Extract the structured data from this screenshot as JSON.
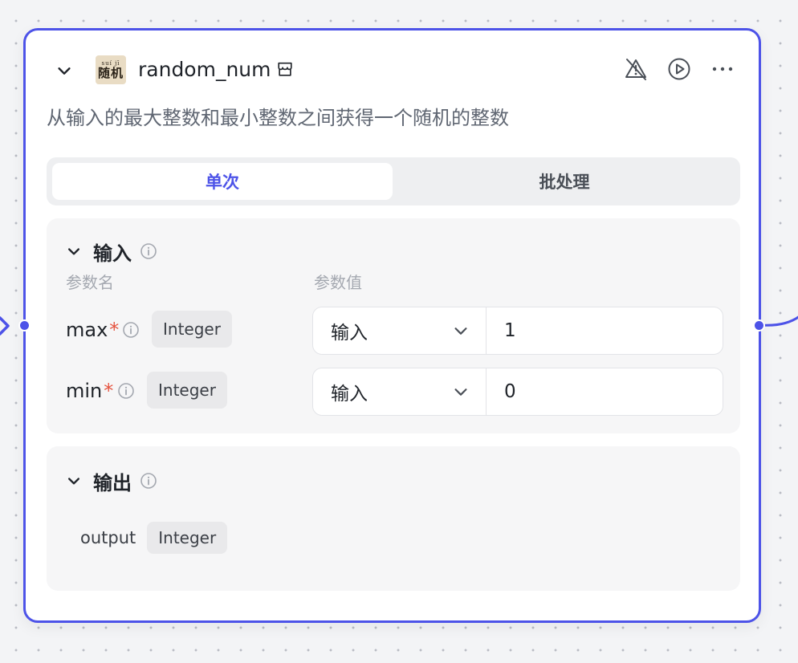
{
  "node": {
    "title": "random_num",
    "description": "从输入的最大整数和最小整数之间获得一个随机的整数",
    "logo": {
      "pinyin": "suí jī",
      "hanzi": "随机"
    },
    "accent_color": "#4d53e8"
  },
  "mode_tabs": [
    {
      "label": "单次",
      "active": true
    },
    {
      "label": "批处理",
      "active": false
    }
  ],
  "inputs": {
    "title": "输入",
    "col_name_label": "参数名",
    "col_value_label": "参数值",
    "params": [
      {
        "name": "max",
        "required_mark": "*",
        "type": "Integer",
        "source": "输入",
        "value": "1"
      },
      {
        "name": "min",
        "required_mark": "*",
        "type": "Integer",
        "source": "输入",
        "value": "0"
      }
    ]
  },
  "outputs": {
    "title": "输出",
    "params": [
      {
        "name": "output",
        "type": "Integer"
      }
    ]
  },
  "icons": {
    "collapse": "chevron-down-icon",
    "store": "store-icon",
    "debug_off": "bug-off-icon",
    "run": "play-circle-icon",
    "more": "more-horizontal-icon",
    "info": "info-circle-icon"
  }
}
